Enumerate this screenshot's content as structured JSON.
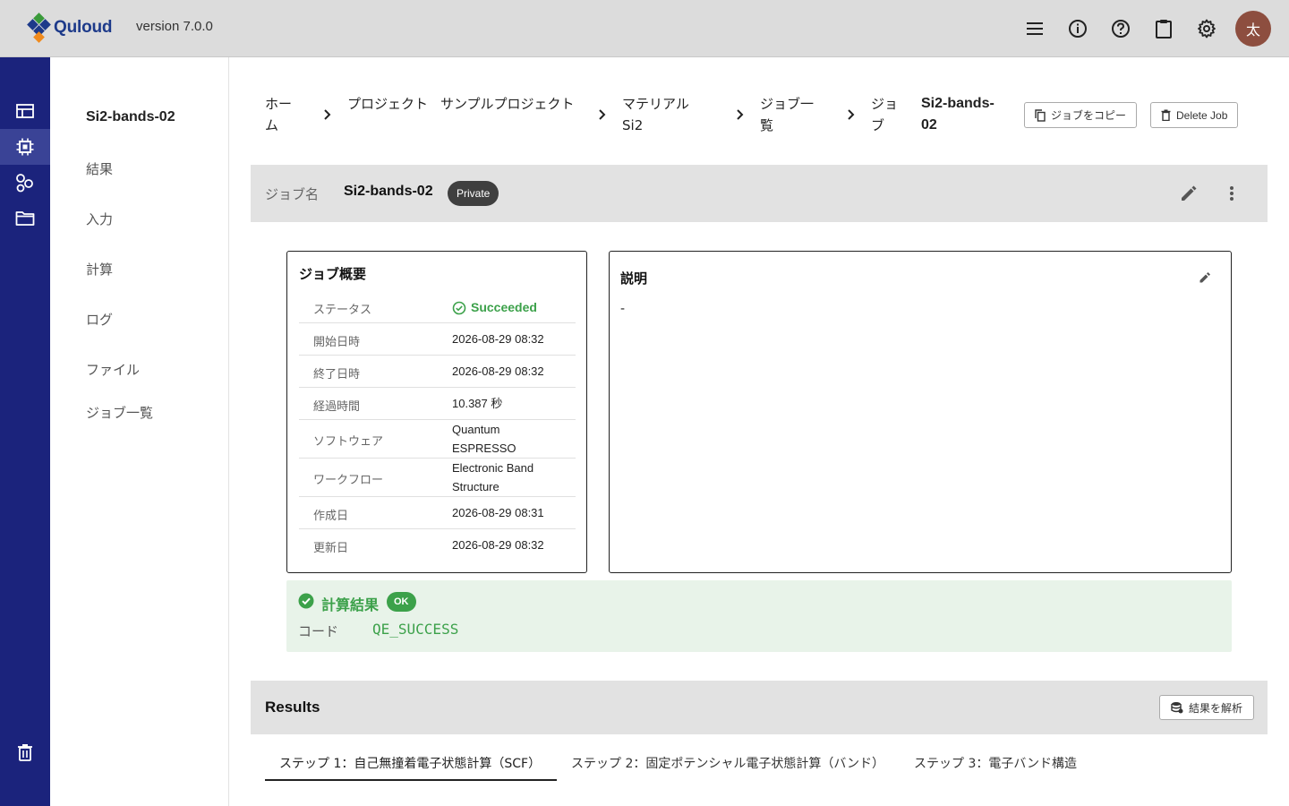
{
  "app": {
    "logo_text": "Quloud",
    "version": "version 7.0.0",
    "avatar_initial": "太",
    "top_icons": [
      "menu-icon",
      "info-icon",
      "help-icon",
      "clipboard-icon",
      "gear-icon"
    ]
  },
  "rail": {
    "items": [
      "table-icon",
      "chip-icon",
      "shapes-icon",
      "folder-icon"
    ],
    "bottom": "trash-icon"
  },
  "subnav": {
    "title": "Si2-bands-02",
    "items": [
      "結果",
      "入力",
      "計算",
      "ログ",
      "ファイル",
      "ジョブ一覧"
    ]
  },
  "breadcrumb": {
    "home": "ホーム",
    "project_label": "プロジェクト",
    "project_name": "サンプルプロジェクト",
    "material_label": "マテリアル",
    "material_name": "Si2",
    "joblist": "ジョブ一覧",
    "job_label": "ジョブ",
    "job_name": "Si2-bands-02"
  },
  "actions": {
    "copy_job": "ジョブをコピー",
    "delete_job": "Delete Job"
  },
  "jobbar": {
    "label": "ジョブ名",
    "name": "Si2-bands-02",
    "visibility": "Private"
  },
  "overview": {
    "title": "ジョブ概要",
    "status_label": "ステータス",
    "status_value": "Succeeded",
    "rows": [
      {
        "label": "開始日時",
        "value": "2026-08-29 08:32"
      },
      {
        "label": "終了日時",
        "value": "2026-08-29 08:32"
      },
      {
        "label": "経過時間",
        "value": "10.387 秒"
      },
      {
        "label": "ソフトウェア",
        "value": "Quantum ESPRESSO"
      },
      {
        "label": "ワークフロー",
        "value": "Electronic Band Structure"
      },
      {
        "label": "作成日",
        "value": "2026-08-29 08:31"
      },
      {
        "label": "更新日",
        "value": "2026-08-29 08:32"
      }
    ]
  },
  "description": {
    "title": "説明",
    "text": "-"
  },
  "calc_result": {
    "title": "計算結果",
    "badge": "OK",
    "code_label": "コード",
    "code": "QE_SUCCESS",
    "color": "#3ca14a"
  },
  "results": {
    "title": "Results",
    "analyze_button": "結果を解析",
    "tabs": [
      "ステップ 1：自己無撞着電子状態計算（SCF）",
      "ステップ 2：固定ポテンシャル電子状態計算（バンド）",
      "ステップ 3：電子バンド構造"
    ]
  },
  "colors": {
    "rail": "#1b237c",
    "header": "#dcdcdc",
    "success": "#3ca14a",
    "avatar": "#8d4e3f"
  }
}
